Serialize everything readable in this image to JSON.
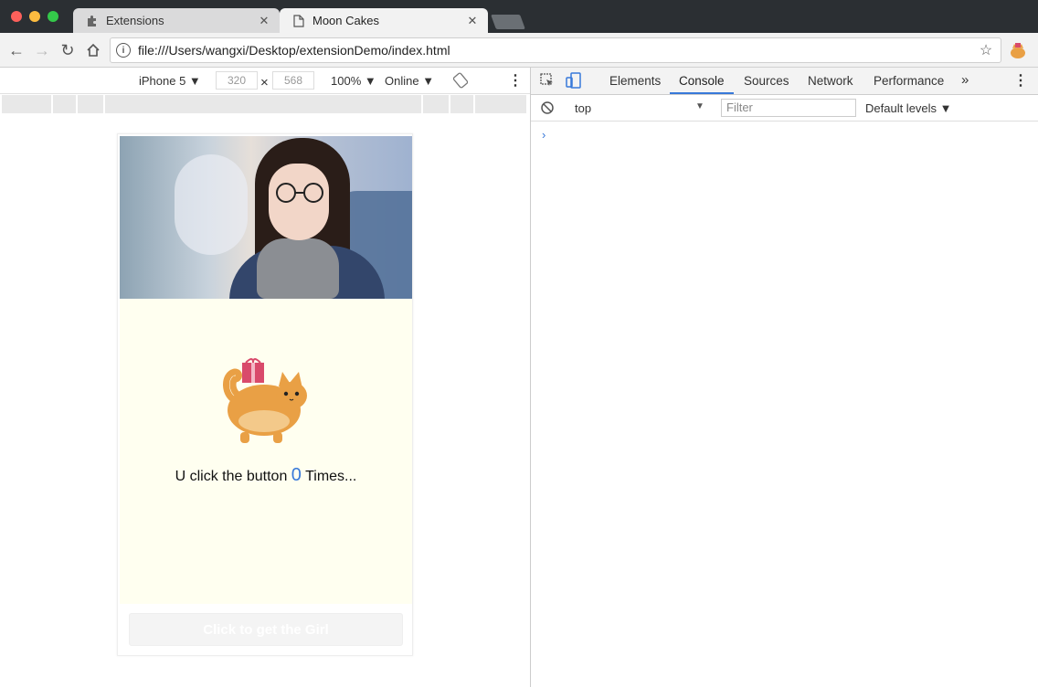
{
  "browser": {
    "tabs": [
      {
        "title": "Extensions",
        "icon": "puzzle-icon",
        "active": false
      },
      {
        "title": "Moon Cakes",
        "icon": "page-icon",
        "active": true
      }
    ],
    "address_url": "file:///Users/wangxi/Desktop/extensionDemo/index.html"
  },
  "device_toolbar": {
    "device": "iPhone 5 ▼",
    "width": "320",
    "height": "568",
    "zoom": "100% ▼",
    "network": "Online ▼"
  },
  "devtools": {
    "tabs": [
      "Elements",
      "Console",
      "Sources",
      "Network",
      "Performance"
    ],
    "active_tab": "Console",
    "context": "top",
    "filter_placeholder": "Filter",
    "levels": "Default levels ▼",
    "prompt": "›"
  },
  "page": {
    "click_prefix": "U click the button",
    "click_count": "0",
    "click_suffix": "Times...",
    "button_label": "Click to get the Girl"
  }
}
